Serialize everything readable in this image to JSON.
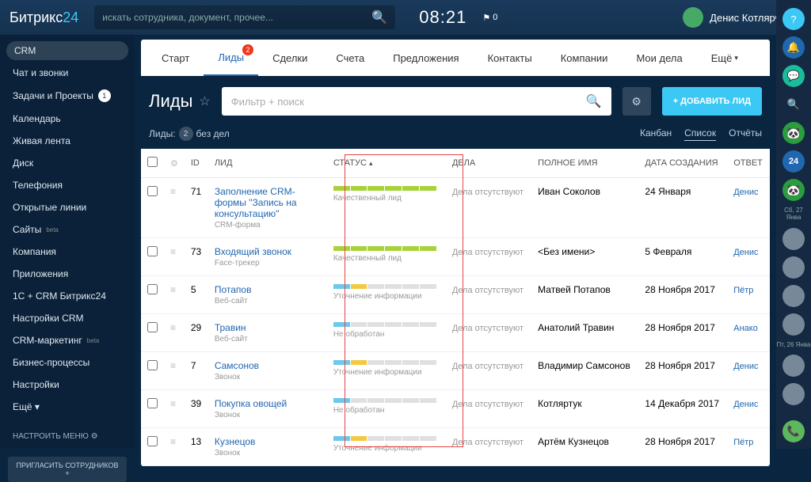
{
  "header": {
    "logo_a": "Битрикс",
    "logo_b": "24",
    "search_placeholder": "искать сотрудника, документ, прочее...",
    "clock": "08:21",
    "flag_count": "0",
    "user_name": "Денис Котлярчук"
  },
  "sidebar": {
    "items": [
      {
        "label": "CRM",
        "active": true
      },
      {
        "label": "Чат и звонки"
      },
      {
        "label": "Задачи и Проекты",
        "badge": "1"
      },
      {
        "label": "Календарь"
      },
      {
        "label": "Живая лента"
      },
      {
        "label": "Диск"
      },
      {
        "label": "Телефония"
      },
      {
        "label": "Открытые линии"
      },
      {
        "label": "Сайты",
        "beta": "beta"
      },
      {
        "label": "Компания"
      },
      {
        "label": "Приложения"
      },
      {
        "label": "1С + CRM Битрикс24"
      },
      {
        "label": "Настройки CRM"
      },
      {
        "label": "CRM-маркетинг",
        "beta": "beta"
      },
      {
        "label": "Бизнес-процессы"
      },
      {
        "label": "Настройки"
      },
      {
        "label": "Ещё ▾"
      }
    ],
    "settings_menu": "НАСТРОИТЬ МЕНЮ",
    "invite": "ПРИГЛАСИТЬ СОТРУДНИКОВ +"
  },
  "crm_tabs": [
    {
      "label": "Старт"
    },
    {
      "label": "Лиды",
      "active": true,
      "badge": "2"
    },
    {
      "label": "Сделки"
    },
    {
      "label": "Счета"
    },
    {
      "label": "Предложения"
    },
    {
      "label": "Контакты"
    },
    {
      "label": "Компании"
    },
    {
      "label": "Мои дела"
    },
    {
      "label": "Ещё",
      "caret": true
    }
  ],
  "page": {
    "title": "Лиды",
    "filter_placeholder": "Фильтр + поиск",
    "add_button": "+ ДОБАВИТЬ ЛИД",
    "sub_label_a": "Лиды:",
    "sub_count": "2",
    "sub_label_b": "без дел",
    "views": {
      "kanban": "Канбан",
      "list": "Список",
      "reports": "Отчёты"
    }
  },
  "table": {
    "headers": {
      "id": "ID",
      "lead": "ЛИД",
      "status": "СТАТУС",
      "deals": "ДЕЛА",
      "fullname": "ПОЛНОЕ ИМЯ",
      "date": "ДАТА СОЗДАНИЯ",
      "resp": "ОТВЕТ"
    },
    "rows": [
      {
        "id": "71",
        "lead": "Заполнение CRM-формы \"Запись на консультацию\"",
        "lead_sub": "CRM-форма",
        "status_text": "Качественный лид",
        "status_type": "green_full",
        "deals": "Дела отсутствуют",
        "name": "Иван Соколов",
        "date": "24 Января",
        "resp": "Денис"
      },
      {
        "id": "73",
        "lead": "Входящий звонок",
        "lead_sub": "Face-трекер",
        "status_text": "Качественный лид",
        "status_type": "green_full",
        "deals": "Дела отсутствуют",
        "name": "<Без имени>",
        "date": "5 Февраля",
        "resp": "Денис"
      },
      {
        "id": "5",
        "lead": "Потапов",
        "lead_sub": "Веб-сайт",
        "status_text": "Уточнение информации",
        "status_type": "blue_yellow",
        "deals": "Дела отсутствуют",
        "name": "Матвей Потапов",
        "date": "28 Ноября 2017",
        "resp": "Пётр"
      },
      {
        "id": "29",
        "lead": "Травин",
        "lead_sub": "Веб-сайт",
        "status_text": "Не обработан",
        "status_type": "blue_only",
        "deals": "Дела отсутствуют",
        "name": "Анатолий Травин",
        "date": "28 Ноября 2017",
        "resp": "Анако"
      },
      {
        "id": "7",
        "lead": "Самсонов",
        "lead_sub": "Звонок",
        "status_text": "Уточнение информации",
        "status_type": "blue_yellow",
        "deals": "Дела отсутствуют",
        "name": "Владимир Самсонов",
        "date": "28 Ноября 2017",
        "resp": "Денис"
      },
      {
        "id": "39",
        "lead": "Покупка овощей",
        "lead_sub": "Звонок",
        "status_text": "Не обработан",
        "status_type": "blue_only",
        "deals": "Дела отсутствуют",
        "name": "Котляртук",
        "date": "14 Декабря 2017",
        "resp": "Денис"
      },
      {
        "id": "13",
        "lead": "Кузнецов",
        "lead_sub": "Звонок",
        "status_text": "Уточнение информации",
        "status_type": "blue_yellow",
        "deals": "Дела отсутствуют",
        "name": "Артём Кузнецов",
        "date": "28 Ноября 2017",
        "resp": "Пётр"
      }
    ]
  },
  "rail": {
    "b24": "24",
    "date1": "Сб, 27 Янва",
    "date2": "Пт, 26 Янва"
  }
}
